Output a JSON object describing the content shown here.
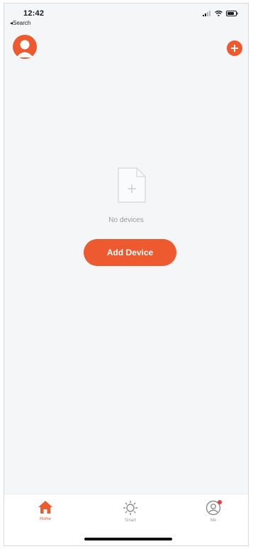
{
  "status_bar": {
    "time": "12:42",
    "back_label": "◂Search"
  },
  "header": {
    "avatar_icon": "user-avatar-icon",
    "add_icon": "plus-circle-icon"
  },
  "empty_state": {
    "icon": "blank-document-plus-icon",
    "message": "No devices",
    "button_label": "Add Device"
  },
  "tab_bar": {
    "items": [
      {
        "label": "Home",
        "icon": "home-icon",
        "active": true
      },
      {
        "label": "Smart",
        "icon": "sun-icon",
        "active": false
      },
      {
        "label": "Me",
        "icon": "profile-icon",
        "active": false,
        "badge": true
      }
    ]
  },
  "colors": {
    "accent": "#ee5a2f",
    "background": "#f5f6f8",
    "muted_text": "#9a9a9a"
  }
}
